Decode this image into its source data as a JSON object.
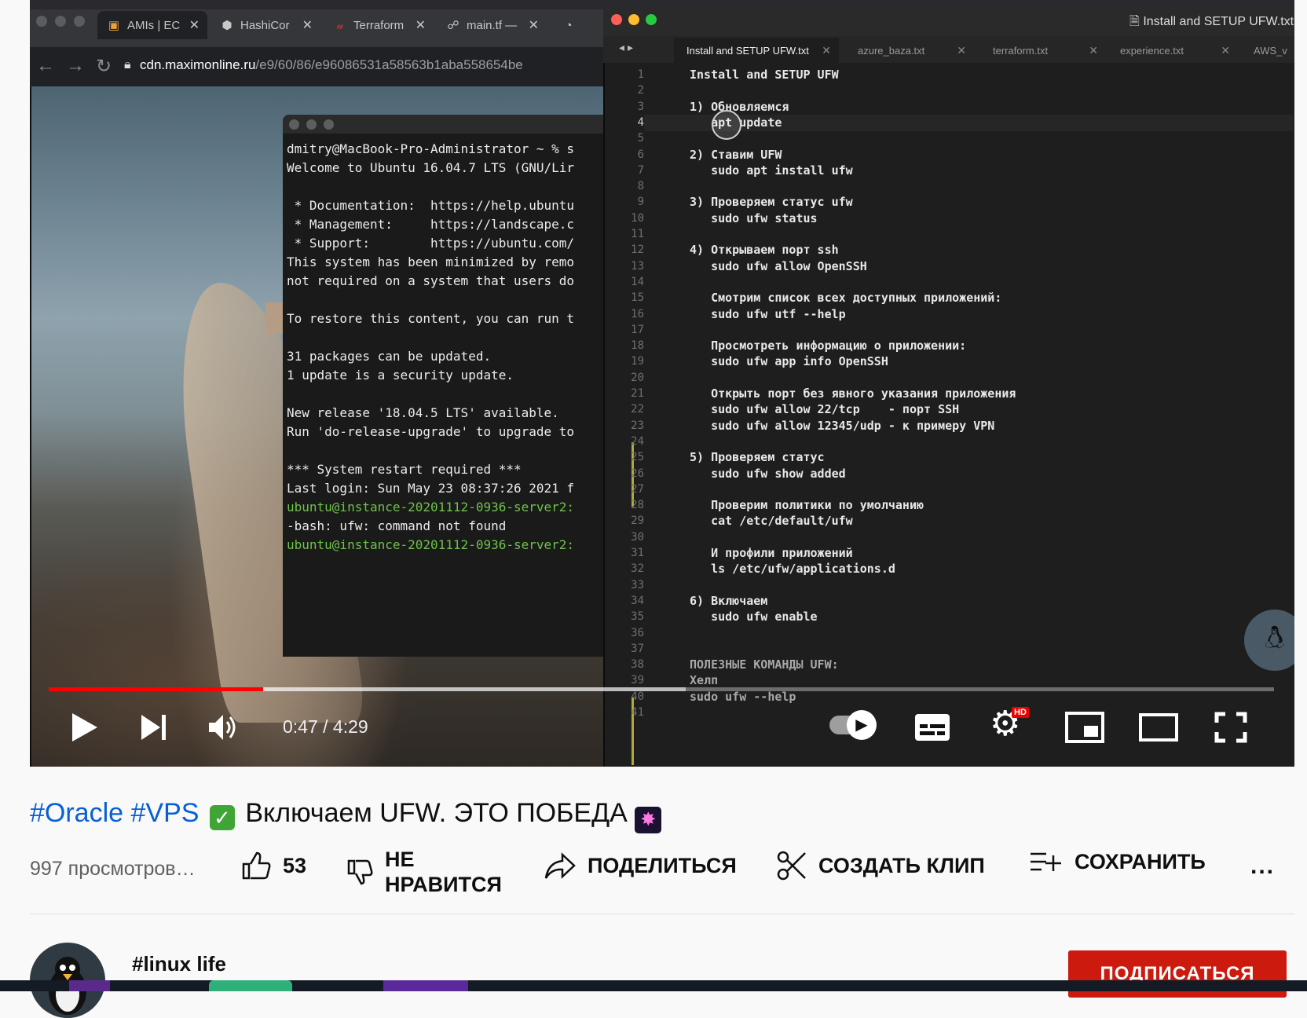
{
  "browser": {
    "tabs": [
      {
        "label": "AMIs | EC",
        "icon": "aws-cube-icon"
      },
      {
        "label": "HashiCor",
        "icon": "hashicorp-icon"
      },
      {
        "label": "Terraform",
        "icon": "terraform-icon"
      },
      {
        "label": "main.tf —",
        "icon": "github-icon"
      }
    ],
    "url_host": "cdn.maximonline.ru",
    "url_path": "/e9/60/86/e96086531a58563b1aba558654be"
  },
  "terminal": {
    "lines": [
      {
        "text": "dmitry@MacBook-Pro-Administrator ~ % s",
        "green": false
      },
      {
        "text": "Welcome to Ubuntu 16.04.7 LTS (GNU/Lir",
        "green": false
      },
      {
        "text": "",
        "green": false
      },
      {
        "text": " * Documentation:  https://help.ubuntu",
        "green": false
      },
      {
        "text": " * Management:     https://landscape.c",
        "green": false
      },
      {
        "text": " * Support:        https://ubuntu.com/",
        "green": false
      },
      {
        "text": "This system has been minimized by remo",
        "green": false
      },
      {
        "text": "not required on a system that users do",
        "green": false
      },
      {
        "text": "",
        "green": false
      },
      {
        "text": "To restore this content, you can run t",
        "green": false
      },
      {
        "text": "",
        "green": false
      },
      {
        "text": "31 packages can be updated.",
        "green": false
      },
      {
        "text": "1 update is a security update.",
        "green": false
      },
      {
        "text": "",
        "green": false
      },
      {
        "text": "New release '18.04.5 LTS' available.",
        "green": false
      },
      {
        "text": "Run 'do-release-upgrade' to upgrade to",
        "green": false
      },
      {
        "text": "",
        "green": false
      },
      {
        "text": "*** System restart required ***",
        "green": false
      },
      {
        "text": "Last login: Sun May 23 08:37:26 2021 f",
        "green": false
      },
      {
        "text": "ubuntu@instance-20201112-0936-server2:",
        "green": true
      },
      {
        "text": "-bash: ufw: command not found",
        "green": false
      },
      {
        "text": "ubuntu@instance-20201112-0936-server2:",
        "green": true
      }
    ]
  },
  "editor": {
    "window_title": "Install and SETUP UFW.txt",
    "tabs": [
      "Install and SETUP UFW.txt",
      "azure_baza.txt",
      "terraform.txt",
      "experience.txt",
      "AWS_v"
    ],
    "current_line": 4,
    "lines": [
      "Install and SETUP UFW",
      "",
      "1) Обновляемся",
      "   apt update",
      "",
      "2) Ставим UFW",
      "   sudo apt install ufw",
      "",
      "3) Проверяем статус ufw",
      "   sudo ufw status",
      "",
      "4) Открываем порт ssh",
      "   sudo ufw allow OpenSSH",
      "",
      "   Смотрим список всех доступных приложений:",
      "   sudo ufw utf --help",
      "",
      "   Просмотреть информацию о приложении:",
      "   sudo ufw app info OpenSSH",
      "",
      "   Открыть порт без явного указания приложения",
      "   sudo ufw allow 22/tcp    - порт SSH",
      "   sudo ufw allow 12345/udp - к примеру VPN",
      "",
      "5) Проверяем статус",
      "   sudo ufw show added",
      "",
      "   Проверим политики по умолчанию",
      "   cat /etc/default/ufw",
      "",
      "   И профили приложений",
      "   ls /etc/ufw/applications.d",
      "",
      "6) Включаем",
      "   sudo ufw enable",
      "",
      "",
      "ПОЛЕЗНЫЕ КОМАНДЫ UFW:",
      "Хелп",
      "sudo ufw --help",
      ""
    ]
  },
  "player": {
    "time": "0:47 / 4:29",
    "played_fraction": 0.175,
    "buffered_fraction": 0.52,
    "hd_badge": "HD",
    "autoplay_on": true
  },
  "video": {
    "title_tags": "#Oracle #VPS",
    "title_text": "Включаем UFW. ЭТО ПОБЕДА",
    "views": "997 просмотров…",
    "likes": "53",
    "dislike_label": "НЕ\nНРАВИТСЯ",
    "share_label": "ПОДЕЛИТЬСЯ",
    "clip_label": "СОЗДАТЬ КЛИП",
    "save_label": "СОХРАНИТЬ",
    "more": "..."
  },
  "channel": {
    "name": "#linux life",
    "subscribe_label": "ПОДПИСАТЬСЯ"
  },
  "colors": {
    "accent_red": "#ff0000",
    "link_blue": "#065fd4",
    "subscribe_red": "#cc1a0e",
    "terminal_green": "#6fc24a"
  }
}
